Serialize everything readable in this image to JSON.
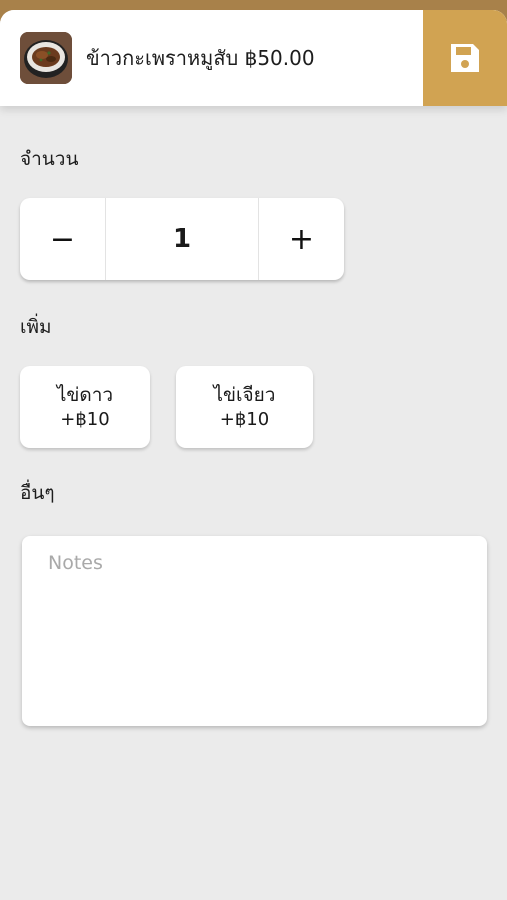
{
  "header": {
    "item_title": "ข้าวกะเพราหมูสับ ฿50.00",
    "thumbnail_icon": "food-bowl-thumbnail",
    "save_icon": "floppy-disk-icon",
    "accent_color": "#d1a352"
  },
  "quantity": {
    "label": "จำนวน",
    "minus": "−",
    "value": "1",
    "plus": "+"
  },
  "addons": {
    "label": "เพิ่ม",
    "options": [
      {
        "name": "ไข่ดาว",
        "price": "+฿10"
      },
      {
        "name": "ไข่เจียว",
        "price": "+฿10"
      }
    ]
  },
  "other": {
    "label": "อื่นๆ",
    "notes_placeholder": "Notes"
  }
}
